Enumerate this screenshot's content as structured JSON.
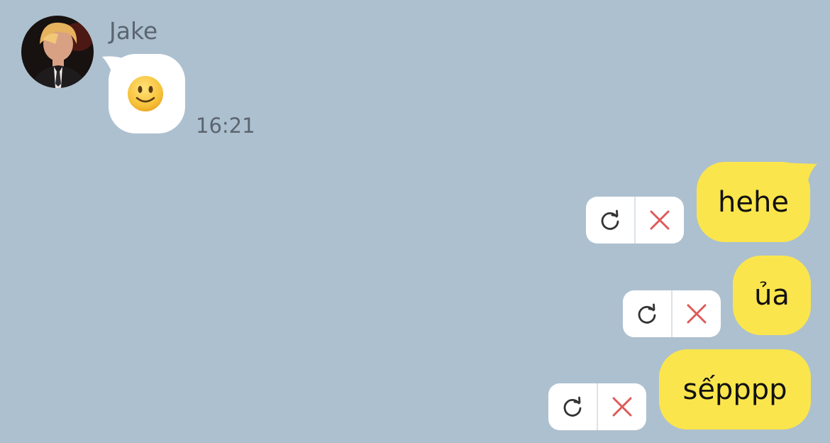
{
  "chat": {
    "incoming": {
      "sender_name": "Jake",
      "message": "🙂",
      "timestamp": "16:21"
    },
    "outgoing": [
      {
        "text": "hehe",
        "status": "failed"
      },
      {
        "text": "ủa",
        "status": "failed"
      },
      {
        "text": "sếpppp",
        "status": "failed"
      }
    ]
  },
  "icons": {
    "retry": "retry-icon",
    "delete": "close-icon"
  },
  "colors": {
    "background": "#adc0cf",
    "incoming_bubble": "#ffffff",
    "outgoing_bubble": "#fbe54c",
    "delete_icon": "#de5a5a",
    "muted_text": "#5b6570"
  }
}
